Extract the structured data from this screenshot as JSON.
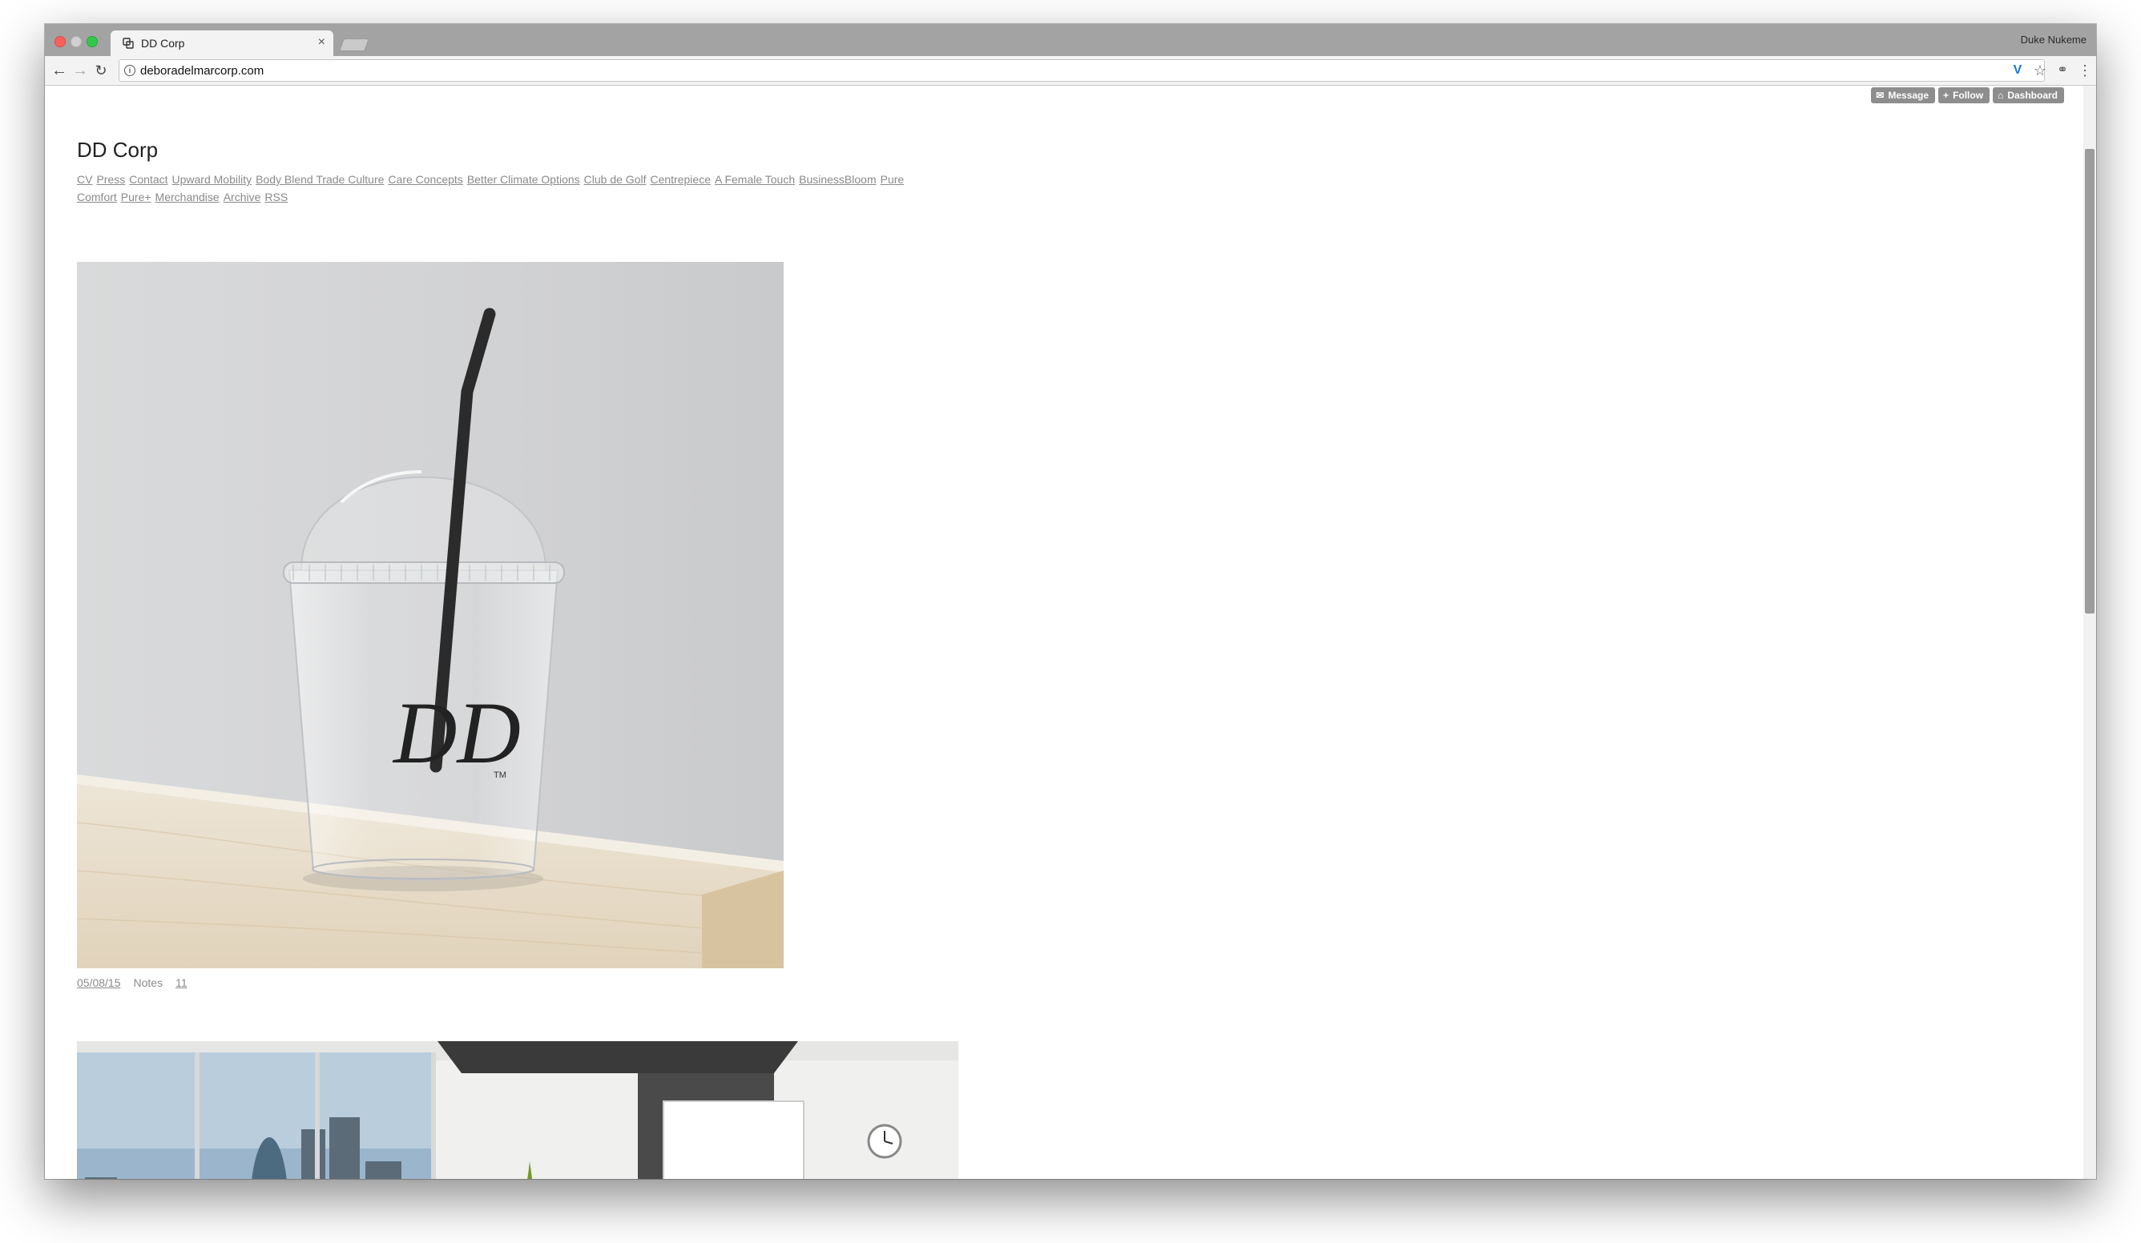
{
  "browser": {
    "tab_title": "DD Corp",
    "tab_close": "×",
    "profile_name": "Duke Nukeme",
    "url": "deboradelmarcorp.com",
    "icons": {
      "back": "back-arrow-icon",
      "forward": "forward-arrow-icon",
      "reload": "reload-icon",
      "info": "info-icon",
      "extension": "vivaldi-icon",
      "bookmark": "star-icon",
      "extension2": "extension-icon",
      "menu": "menu-icon"
    }
  },
  "tumblr_controls": {
    "message": "Message",
    "follow": "Follow",
    "dashboard": "Dashboard"
  },
  "site": {
    "title": "DD Corp",
    "nav": [
      "CV",
      "Press",
      "Contact",
      "Upward Mobility",
      "Body Blend Trade Culture",
      "Care Concepts",
      "Better Climate Options",
      "Club de Golf",
      "Centrepiece",
      "A Female Touch",
      "BusinessBloom",
      "Pure Comfort",
      "Pure+",
      "Merchandise",
      "Archive",
      "RSS"
    ]
  },
  "posts": [
    {
      "image": "clear plastic dome-lid cup with black straw and DD logo on wooden table",
      "date": "05/08/15",
      "notes_label": "Notes",
      "notes_count": "11",
      "logo_text": "DD",
      "logo_tm": "TM"
    },
    {
      "image": "modern office meeting room with city skyline windows, projection screen and wall clock"
    }
  ],
  "colors": {
    "tab_bar": "#a3a3a3",
    "toolbar": "#f3f3f3",
    "link": "#8a8a8a",
    "button": "#8e8e8e"
  }
}
